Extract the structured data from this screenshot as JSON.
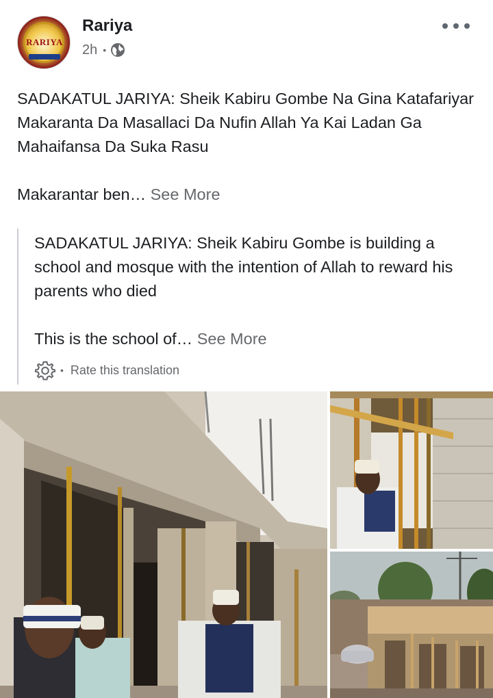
{
  "post": {
    "page_name": "Rariya",
    "time": "2h",
    "privacy_icon": "globe-icon",
    "avatar_logo_text": "RARIYA",
    "paragraph_1": "SADAKATUL JARIYA: Sheik Kabiru Gombe Na Gina Katafariyar Makaranta Da Masallaci Da Nufin Allah Ya Kai Ladan Ga Mahaifansa Da Suka Rasu",
    "paragraph_2": "Makarantar ben…",
    "see_more_label": "See More"
  },
  "translation": {
    "paragraph_1": "SADAKATUL JARIYA: Sheik Kabiru Gombe is building a school and mosque with the intention of Allah to reward his parents who died",
    "paragraph_2": "This is the school of…",
    "see_more_label": "See More",
    "rate_label": "Rate this translation",
    "settings_icon": "gear-icon"
  },
  "photos": [
    {
      "name": "construction-photo-main"
    },
    {
      "name": "construction-photo-interior"
    },
    {
      "name": "construction-photo-roof"
    }
  ],
  "colors": {
    "text_primary": "#1c1e21",
    "text_secondary": "#65676b",
    "divider": "#c9ccd1"
  }
}
